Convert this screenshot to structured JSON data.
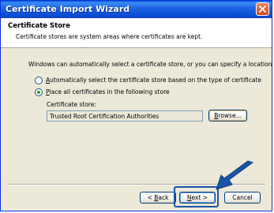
{
  "window": {
    "title": "Certificate Import Wizard"
  },
  "header": {
    "title": "Certificate Store",
    "description": "Certificate stores are system areas where certificates are kept."
  },
  "body": {
    "intro": "Windows can automatically select a certificate store, or you can specify a location for",
    "options": [
      {
        "label_pre": "",
        "label_key": "A",
        "label_post": "utomatically select the certificate store based on the type of certificate",
        "selected": false
      },
      {
        "label_pre": "",
        "label_key": "P",
        "label_post": "lace all certificates in the following store",
        "selected": true
      }
    ],
    "store_label": "Certificate store:",
    "store_value": "Trusted Root Certification Authorities",
    "browse_label_key": "B",
    "browse_label_post": "rowse..."
  },
  "footer": {
    "back_pre": "< ",
    "back_key": "B",
    "back_post": "ack",
    "next_key": "N",
    "next_post": "ext >",
    "cancel_label": "Cancel"
  },
  "colors": {
    "titlebar": "#0a5fdc",
    "radio_selected": "#21a121",
    "annotation_arrow": "#1a54a8"
  },
  "icons": {
    "close": "close-icon",
    "annotation": "arrow-pointer-icon"
  }
}
